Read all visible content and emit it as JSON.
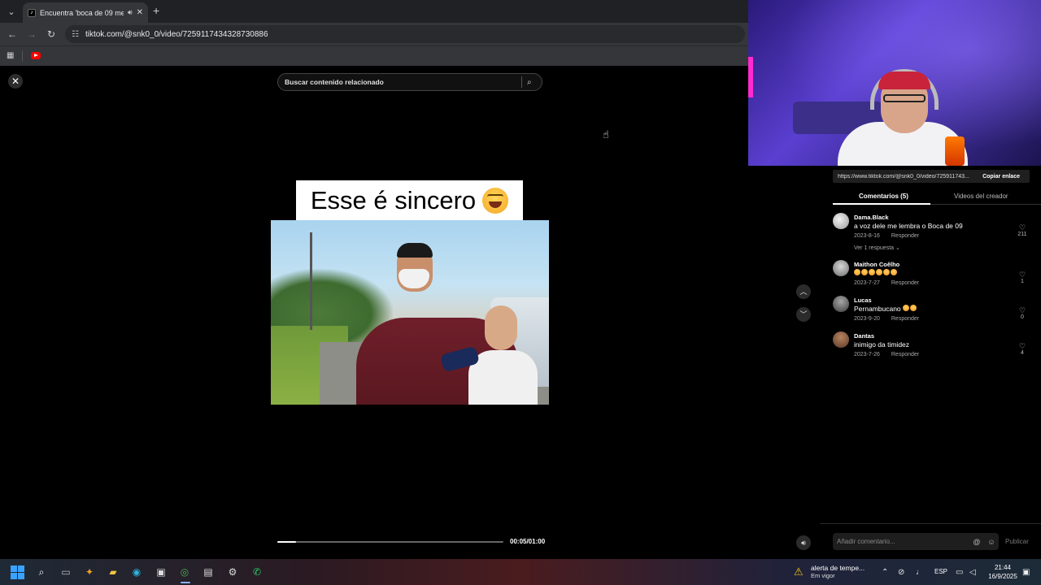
{
  "browser": {
    "tab_title": "Encuentra 'boca de 09 me...",
    "tab_favicon": "tiktok-icon",
    "url": "tiktok.com/@snk0_0/video/7259117434328730886"
  },
  "player": {
    "search_placeholder": "Buscar contenido relacionado",
    "caption": "Esse é sincero",
    "time": "00:05/01:00",
    "progress_fraction": 0.083
  },
  "panel": {
    "share_url": "https://www.tiktok.com/@snk0_0/video/725911743...",
    "copy_link": "Copiar enlace",
    "tabs": [
      {
        "label": "Comentarios (5)"
      },
      {
        "label": "Videos del creador"
      }
    ],
    "comments": [
      {
        "user": "Dama.Black",
        "text": "a voz dele me lembra o Boca de 09",
        "date": "2023-8-16",
        "reply": "Responder",
        "likes": "211",
        "more": "Ver 1 respuesta ⌄"
      },
      {
        "user": "Maithon Coêlho",
        "text": "",
        "emoji_count": 6,
        "date": "2023-7-27",
        "reply": "Responder",
        "likes": "1"
      },
      {
        "user": "Lucas",
        "text": "Pernambucano",
        "emoji_count": 2,
        "date": "2023-9-20",
        "reply": "Responder",
        "likes": "0"
      },
      {
        "user": "Dantas",
        "text": "inimigo da timidez",
        "date": "2023-7-26",
        "reply": "Responder",
        "likes": "4"
      }
    ],
    "comment_placeholder": "Añadir comentario...",
    "publish": "Publicar"
  },
  "taskbar": {
    "weather_title": "alerta de tempe...",
    "weather_sub": "Em vigor",
    "language": "ESP",
    "time": "21:44",
    "date": "16/9/2025"
  }
}
